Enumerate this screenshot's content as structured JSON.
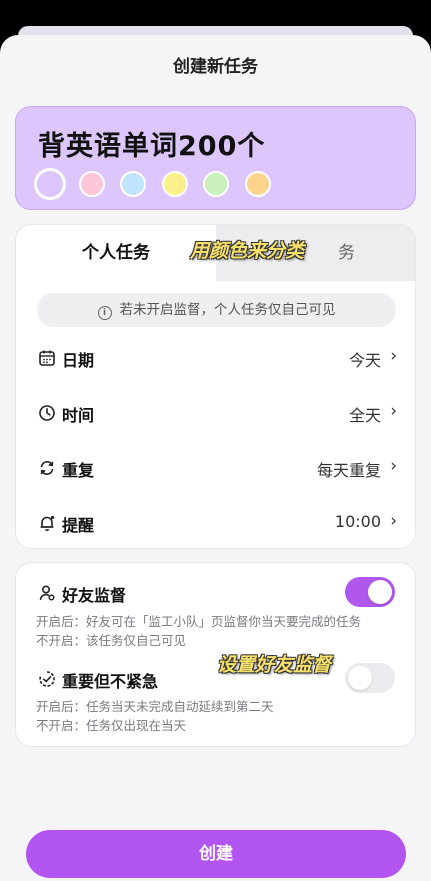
{
  "sheet": {
    "title": "创建新任务"
  },
  "task": {
    "name": "背英语单词200个",
    "colors": [
      "#dcc6fb",
      "#fdc6d8",
      "#bfe4fb",
      "#fdf08a",
      "#c9f0bd",
      "#fdd48d"
    ],
    "selected_color_index": 0
  },
  "tabs": [
    {
      "label": "个人任务",
      "active": true
    },
    {
      "label": "务",
      "active": false
    }
  ],
  "overlays": {
    "color_caption": "用颜色来分类",
    "friend_caption": "设置好友监督"
  },
  "notice": {
    "text": "若未开启监督，个人任务仅自己可见",
    "icon": "info-icon"
  },
  "settings": [
    {
      "label": "日期",
      "value": "今天",
      "icon": "calendar-icon"
    },
    {
      "label": "时间",
      "value": "全天",
      "icon": "clock-icon"
    },
    {
      "label": "重复",
      "value": "每天重复",
      "icon": "repeat-icon"
    },
    {
      "label": "提醒",
      "value": "10:00",
      "icon": "bell-icon"
    }
  ],
  "switches": [
    {
      "title": "好友监督",
      "icon": "friend-supervise-icon",
      "on": true,
      "desc_on": "开启后：好友可在「监工小队」页监督你当天要完成的任务",
      "desc_off": "不开启：该任务仅自己可见"
    },
    {
      "title": "重要但不紧急",
      "icon": "important-icon",
      "on": false,
      "desc_on": "开启后：任务当天未完成自动延续到第二天",
      "desc_off": "不开启：任务仅出现在当天"
    }
  ],
  "create_button": {
    "label": "创建"
  },
  "accent_color": "#b254ef"
}
